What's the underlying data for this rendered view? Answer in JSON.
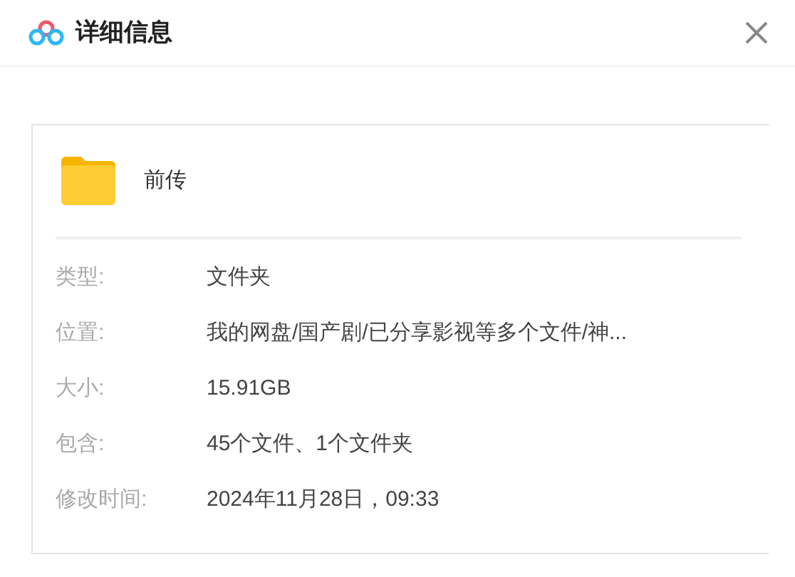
{
  "window": {
    "title": "详细信息"
  },
  "file": {
    "name": "前传"
  },
  "details": [
    {
      "label": "类型:",
      "value": "文件夹"
    },
    {
      "label": "位置:",
      "value": "我的网盘/国产剧/已分享影视等多个文件/神..."
    },
    {
      "label": "大小:",
      "value": "15.91GB"
    },
    {
      "label": "包含:",
      "value": "45个文件、1个文件夹"
    },
    {
      "label": "修改时间:",
      "value": "2024年11月28日，09:33"
    }
  ]
}
